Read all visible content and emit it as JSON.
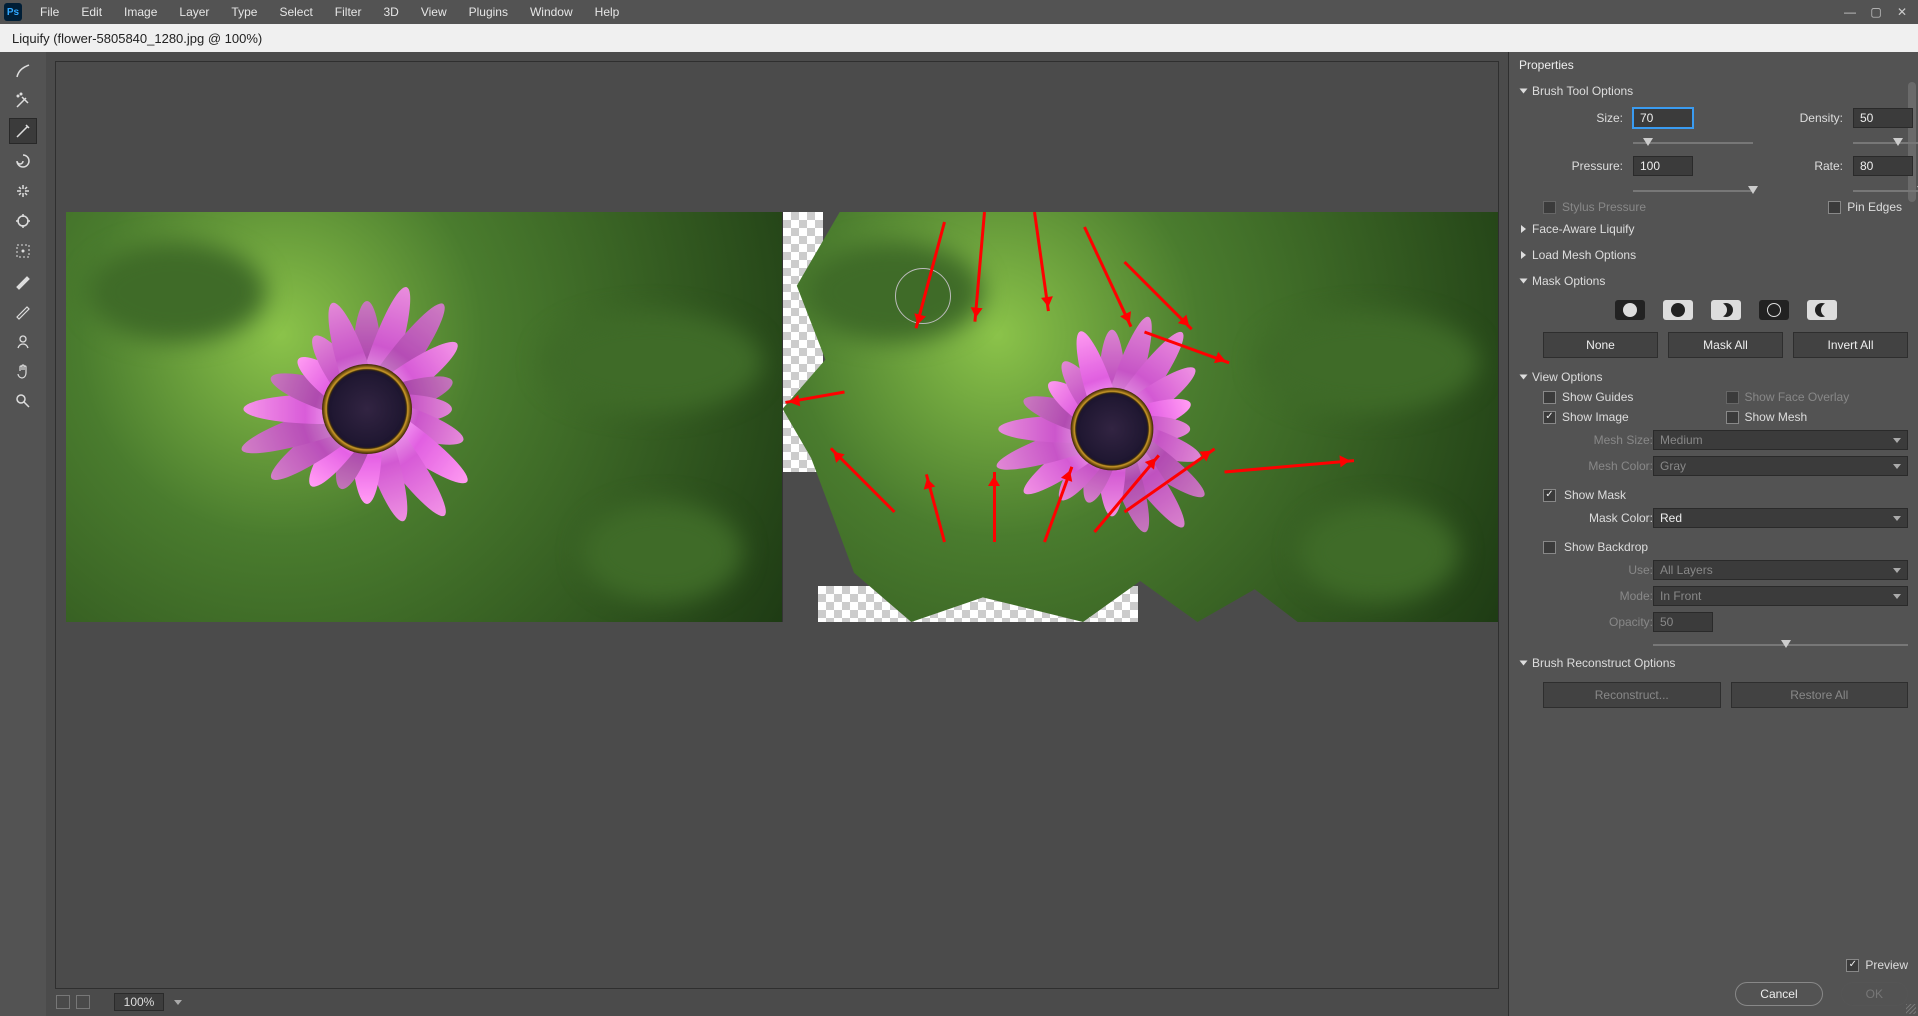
{
  "menu": {
    "items": [
      "File",
      "Edit",
      "Image",
      "Layer",
      "Type",
      "Select",
      "Filter",
      "3D",
      "View",
      "Plugins",
      "Window",
      "Help"
    ]
  },
  "optionbar": {
    "title": "Liquify (flower-5805840_1280.jpg @ 100%)"
  },
  "tools": [
    "forward-warp-tool",
    "reconstruct-tool",
    "smooth-tool",
    "twirl-tool",
    "pucker-tool",
    "bloat-tool",
    "push-left-tool",
    "freeze-mask-tool",
    "thaw-mask-tool",
    "face-tool",
    "hand-tool",
    "zoom-tool"
  ],
  "active_tool_index": 2,
  "status": {
    "zoom": "100%"
  },
  "panel": {
    "title": "Properties",
    "sections": {
      "brush": {
        "label": "Brush Tool Options",
        "size_label": "Size:",
        "size_value": "70",
        "density_label": "Density:",
        "density_value": "50",
        "pressure_label": "Pressure:",
        "pressure_value": "100",
        "rate_label": "Rate:",
        "rate_value": "80",
        "stylus_label": "Stylus Pressure",
        "pinedges_label": "Pin Edges"
      },
      "faceaware": {
        "label": "Face-Aware Liquify"
      },
      "loadmesh": {
        "label": "Load Mesh Options"
      },
      "mask": {
        "label": "Mask Options",
        "none": "None",
        "maskall": "Mask All",
        "invertall": "Invert All"
      },
      "view": {
        "label": "View Options",
        "show_guides": "Show Guides",
        "show_face_overlay": "Show Face Overlay",
        "show_image": "Show Image",
        "show_mesh": "Show Mesh",
        "mesh_size_label": "Mesh Size:",
        "mesh_size_value": "Medium",
        "mesh_color_label": "Mesh Color:",
        "mesh_color_value": "Gray",
        "show_mask": "Show Mask",
        "mask_color_label": "Mask Color:",
        "mask_color_value": "Red",
        "show_backdrop": "Show Backdrop",
        "use_label": "Use:",
        "use_value": "All Layers",
        "mode_label": "Mode:",
        "mode_value": "In Front",
        "opacity_label": "Opacity:",
        "opacity_value": "50"
      },
      "reconstruct": {
        "label": "Brush Reconstruct Options",
        "reconstruct_btn": "Reconstruct...",
        "restore_btn": "Restore All"
      }
    },
    "preview_label": "Preview",
    "cancel": "Cancel",
    "ok": "OK"
  }
}
